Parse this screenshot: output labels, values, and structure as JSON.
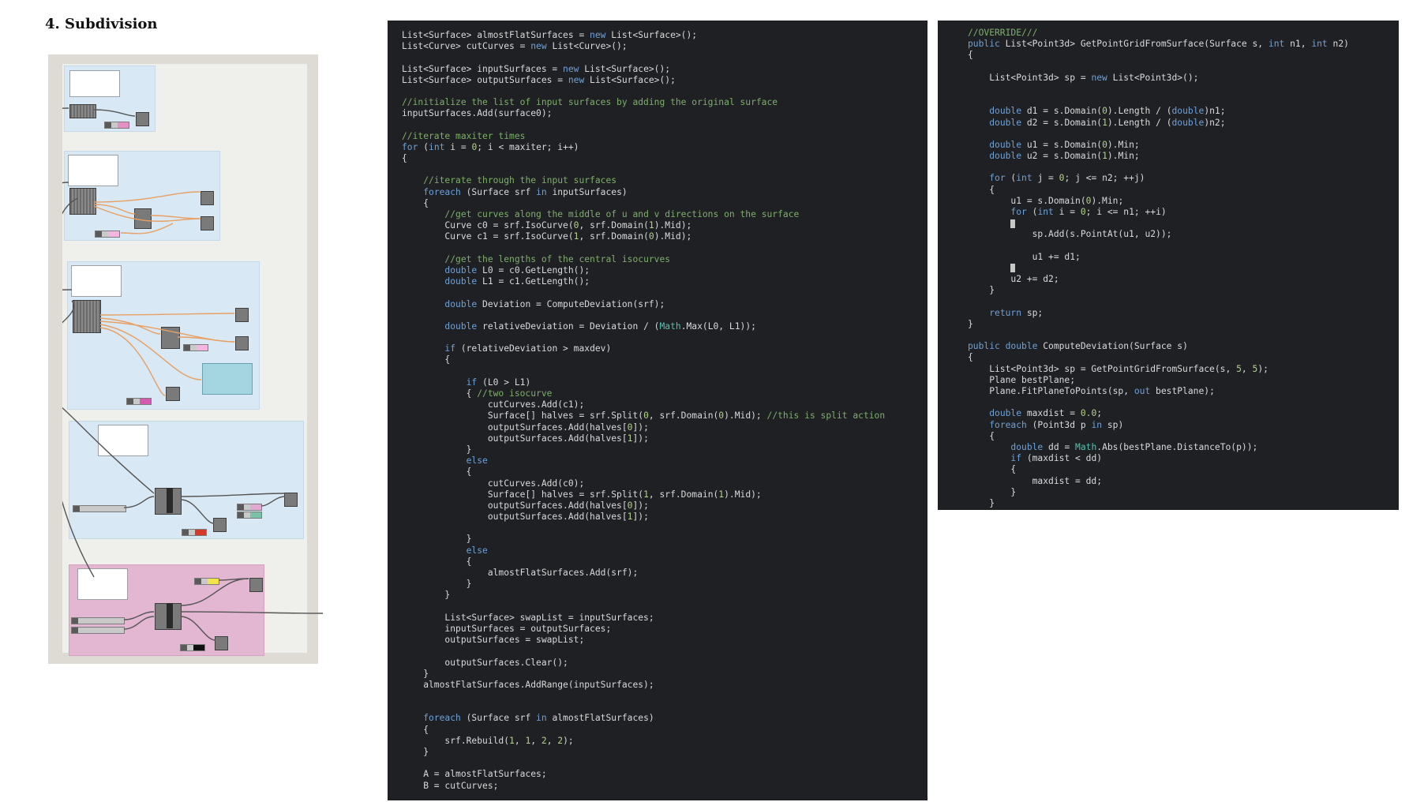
{
  "heading": "4. Subdivision",
  "code_left": [
    "List<Surface> almostFlatSurfaces = new List<Surface>();",
    "List<Curve> cutCurves = new List<Curve>();",
    "",
    "List<Surface> inputSurfaces = new List<Surface>();",
    "List<Surface> outputSurfaces = new List<Surface>();",
    "",
    "//initialize the list of input surfaces by adding the original surface",
    "inputSurfaces.Add(surface0);",
    "",
    "//iterate maxiter times",
    "for (int i = 0; i < maxiter; i++)",
    "{",
    "",
    "    //iterate through the input surfaces",
    "    foreach (Surface srf in inputSurfaces)",
    "    {",
    "        //get curves along the middle of u and v directions on the surface",
    "        Curve c0 = srf.IsoCurve(0, srf.Domain(1).Mid);",
    "        Curve c1 = srf.IsoCurve(1, srf.Domain(0).Mid);",
    "",
    "        //get the lengths of the central isocurves",
    "        double L0 = c0.GetLength();",
    "        double L1 = c1.GetLength();",
    "",
    "        double Deviation = ComputeDeviation(srf);",
    "",
    "        double relativeDeviation = Deviation / (Math.Max(L0, L1));",
    "",
    "        if (relativeDeviation > maxdev)",
    "        {",
    "",
    "            if (L0 > L1)",
    "            { //two isocurve",
    "                cutCurves.Add(c1);",
    "                Surface[] halves = srf.Split(0, srf.Domain(0).Mid); //this is split action",
    "                outputSurfaces.Add(halves[0]);",
    "                outputSurfaces.Add(halves[1]);",
    "            }",
    "            else",
    "            {",
    "                cutCurves.Add(c0);",
    "                Surface[] halves = srf.Split(1, srf.Domain(1).Mid);",
    "                outputSurfaces.Add(halves[0]);",
    "                outputSurfaces.Add(halves[1]);",
    "",
    "            }",
    "            else",
    "            {",
    "                almostFlatSurfaces.Add(srf);",
    "            }",
    "        }",
    "",
    "        List<Surface> swapList = inputSurfaces;",
    "        inputSurfaces = outputSurfaces;",
    "        outputSurfaces = swapList;",
    "",
    "        outputSurfaces.Clear();",
    "    }",
    "    almostFlatSurfaces.AddRange(inputSurfaces);",
    "",
    "",
    "    foreach (Surface srf in almostFlatSurfaces)",
    "    {",
    "        srf.Rebuild(1, 1, 2, 2);",
    "    }",
    "",
    "    A = almostFlatSurfaces;",
    "    B = cutCurves;"
  ],
  "code_right": [
    "//OVERRIDE///",
    "public List<Point3d> GetPointGridFromSurface(Surface s, int n1, int n2)",
    "{",
    "",
    "    List<Point3d> sp = new List<Point3d>();",
    "",
    "",
    "    double d1 = s.Domain(0).Length / (double)n1;",
    "    double d2 = s.Domain(1).Length / (double)n2;",
    "",
    "    double u1 = s.Domain(0).Min;",
    "    double u2 = s.Domain(1).Min;",
    "",
    "    for (int j = 0; j <= n2; ++j)",
    "    {",
    "        u1 = s.Domain(0).Min;",
    "        for (int i = 0; i <= n1; ++i)",
    "        █",
    "            sp.Add(s.PointAt(u1, u2));",
    "",
    "            u1 += d1;",
    "        █",
    "        u2 += d2;",
    "    }",
    "",
    "    return sp;",
    "}",
    "",
    "public double ComputeDeviation(Surface s)",
    "{",
    "    List<Point3d> sp = GetPointGridFromSurface(s, 5, 5);",
    "    Plane bestPlane;",
    "    Plane.FitPlaneToPoints(sp, out bestPlane);",
    "",
    "    double maxdist = 0.0;",
    "    foreach (Point3d p in sp)",
    "    {",
    "        double dd = Math.Abs(bestPlane.DistanceTo(p));",
    "        if (maxdist < dd)",
    "        {",
    "            maxdist = dd;",
    "        }",
    "    }",
    "    return maxdist;",
    "}"
  ],
  "colors": {
    "code_bg": "#1f2023",
    "keyword": "#6ea1d8",
    "comment": "#7eae6a",
    "number": "#b3d28a",
    "group_blue": "#d8e8f4",
    "group_pink": "#e3b6d2",
    "wire_orange": "#e8a063"
  }
}
